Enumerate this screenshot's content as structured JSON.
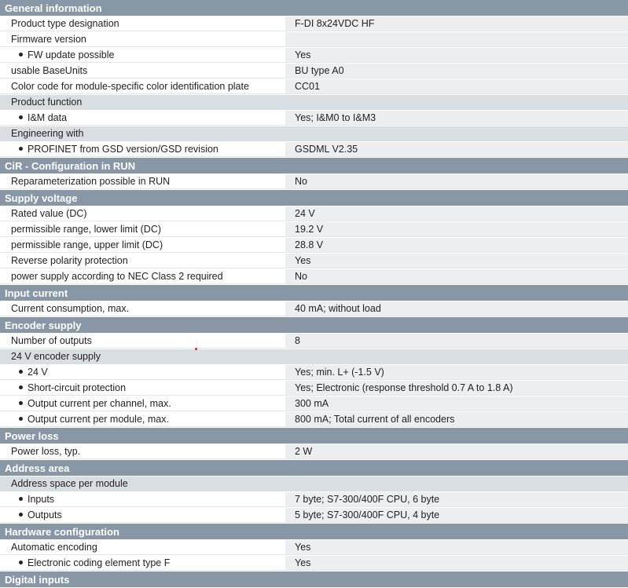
{
  "rows": [
    {
      "type": "section",
      "label": "General information"
    },
    {
      "type": "item",
      "label": "Product type designation",
      "value": "F-DI 8x24VDC HF"
    },
    {
      "type": "item",
      "label": "Firmware version",
      "value": ""
    },
    {
      "type": "sub",
      "label": "FW update possible",
      "value": "Yes"
    },
    {
      "type": "item",
      "label": "usable BaseUnits",
      "value": "BU type A0"
    },
    {
      "type": "item",
      "label": "Color code for module-specific color identification plate",
      "value": "CC01"
    },
    {
      "type": "group",
      "label": "Product function"
    },
    {
      "type": "sub",
      "label": "I&M data",
      "value": "Yes; I&M0 to I&M3"
    },
    {
      "type": "group",
      "label": "Engineering with"
    },
    {
      "type": "sub",
      "label": "PROFINET from GSD version/GSD revision",
      "value": "GSDML V2.35"
    },
    {
      "type": "section",
      "label": "CiR - Configuration in RUN"
    },
    {
      "type": "item",
      "label": "Reparameterization possible in RUN",
      "value": "No"
    },
    {
      "type": "section",
      "label": "Supply voltage"
    },
    {
      "type": "item",
      "label": "Rated value (DC)",
      "value": "24 V"
    },
    {
      "type": "item",
      "label": "permissible range, lower limit (DC)",
      "value": "19.2 V"
    },
    {
      "type": "item",
      "label": "permissible range, upper limit (DC)",
      "value": "28.8 V"
    },
    {
      "type": "item",
      "label": "Reverse polarity protection",
      "value": "Yes"
    },
    {
      "type": "item",
      "label": "power supply according to NEC Class 2 required",
      "value": "No"
    },
    {
      "type": "section",
      "label": "Input current"
    },
    {
      "type": "item",
      "label": "Current consumption, max.",
      "value": "40 mA; without load"
    },
    {
      "type": "section",
      "label": "Encoder supply"
    },
    {
      "type": "item",
      "label": "Number of outputs",
      "value": "8"
    },
    {
      "type": "group",
      "label": "24 V encoder supply"
    },
    {
      "type": "sub",
      "label": "24 V",
      "value": "Yes; min. L+ (-1.5 V)"
    },
    {
      "type": "sub",
      "label": "Short-circuit protection",
      "value": "Yes; Electronic (response threshold 0.7 A to 1.8 A)"
    },
    {
      "type": "sub",
      "label": "Output current per channel, max.",
      "value": "300 mA"
    },
    {
      "type": "sub",
      "label": "Output current per module, max.",
      "value": "800 mA; Total current of all encoders"
    },
    {
      "type": "section",
      "label": "Power loss"
    },
    {
      "type": "item",
      "label": "Power loss, typ.",
      "value": "2 W"
    },
    {
      "type": "section",
      "label": "Address area"
    },
    {
      "type": "group",
      "label": "Address space per module"
    },
    {
      "type": "sub",
      "label": "Inputs",
      "value": "7 byte; S7-300/400F CPU, 6 byte"
    },
    {
      "type": "sub",
      "label": "Outputs",
      "value": "5 byte; S7-300/400F CPU, 4 byte"
    },
    {
      "type": "section",
      "label": "Hardware configuration"
    },
    {
      "type": "item",
      "label": "Automatic encoding",
      "value": "Yes"
    },
    {
      "type": "sub",
      "label": "Electronic coding element type F",
      "value": "Yes"
    },
    {
      "type": "section",
      "label": "Digital inputs"
    }
  ]
}
